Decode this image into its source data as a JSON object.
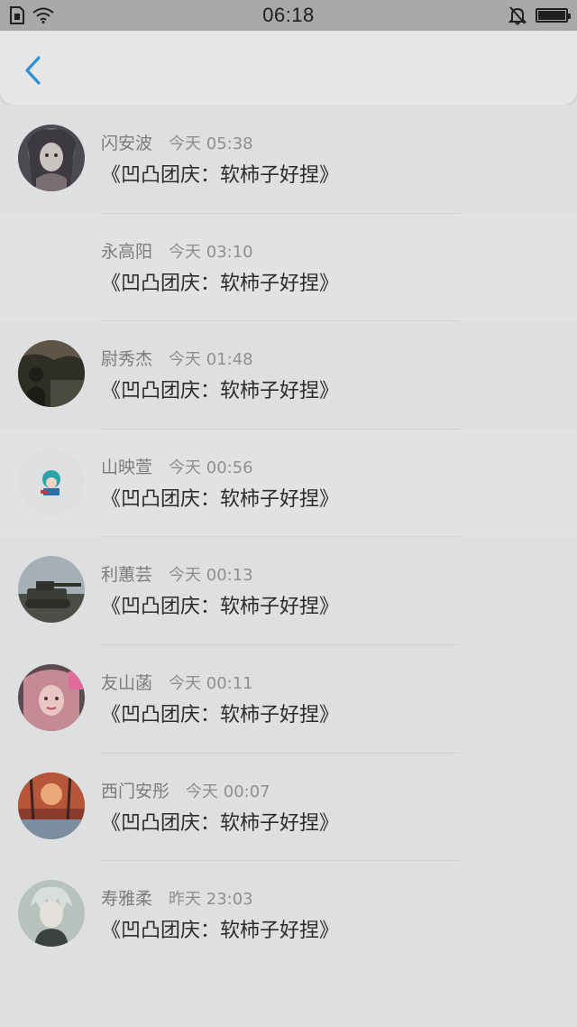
{
  "status_bar": {
    "time": "06:18",
    "icons_left": [
      "sim-icon",
      "wifi-icon"
    ],
    "icons_right": [
      "bell-muted-icon",
      "battery-icon"
    ]
  },
  "header": {
    "back_icon": "chevron-left-icon",
    "accent_color": "#2d8ed6"
  },
  "messages": [
    {
      "name": "闪安波",
      "time": "今天 05:38",
      "title": "《凹凸团庆：软柿子好捏》",
      "avatar": "anime-girl"
    },
    {
      "name": "永高阳",
      "time": "今天 03:10",
      "title": "《凹凸团庆：软柿子好捏》",
      "avatar": "none"
    },
    {
      "name": "尉秀杰",
      "time": "今天 01:48",
      "title": "《凹凸团庆：软柿子好捏》",
      "avatar": "dark-photo"
    },
    {
      "name": "山映萱",
      "time": "今天 00:56",
      "title": "《凹凸团庆：软柿子好捏》",
      "avatar": "small-cartoon"
    },
    {
      "name": "利蕙芸",
      "time": "今天 00:13",
      "title": "《凹凸团庆：软柿子好捏》",
      "avatar": "tank"
    },
    {
      "name": "友山菡",
      "time": "今天 00:11",
      "title": "《凹凸团庆：软柿子好捏》",
      "avatar": "pink-girl"
    },
    {
      "name": "西门安彤",
      "time": "今天 00:07",
      "title": "《凹凸团庆：软柿子好捏》",
      "avatar": "autumn-forest"
    },
    {
      "name": "寿雅柔",
      "time": "昨天 23:03",
      "title": "《凹凸团庆：软柿子好捏》",
      "avatar": "silver-hair"
    }
  ]
}
